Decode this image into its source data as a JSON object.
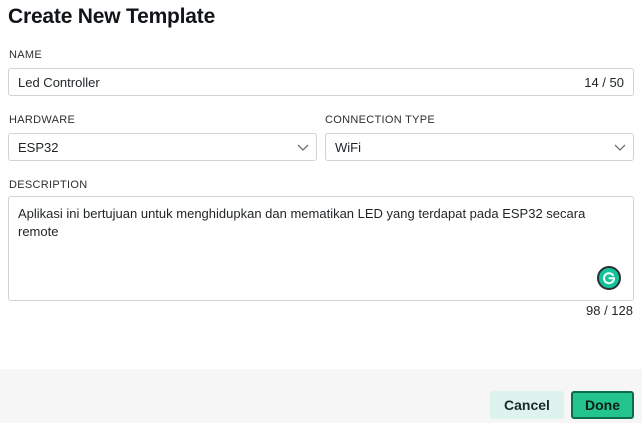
{
  "dialog": {
    "title": "Create New Template"
  },
  "name": {
    "label": "NAME",
    "value": "Led Controller",
    "counter": "14 / 50"
  },
  "hardware": {
    "label": "HARDWARE",
    "value": "ESP32"
  },
  "connection": {
    "label": "CONNECTION TYPE",
    "value": "WiFi"
  },
  "description": {
    "label": "DESCRIPTION",
    "value": "Aplikasi ini bertujuan untuk menghidupkan dan mematikan LED yang terdapat pada ESP32 secara remote",
    "counter": "98 / 128"
  },
  "footer": {
    "cancel_label": "Cancel",
    "done_label": "Done"
  },
  "icons": {
    "dropdown": "chevron-down-icon",
    "grammar": "grammarly-icon"
  },
  "colors": {
    "accent": "#23c48e",
    "accent_border": "#0f6b4d",
    "cancel_bg": "#dff3ee",
    "field_border": "#cfd4d8",
    "footer_bg": "#f6f6f6"
  }
}
